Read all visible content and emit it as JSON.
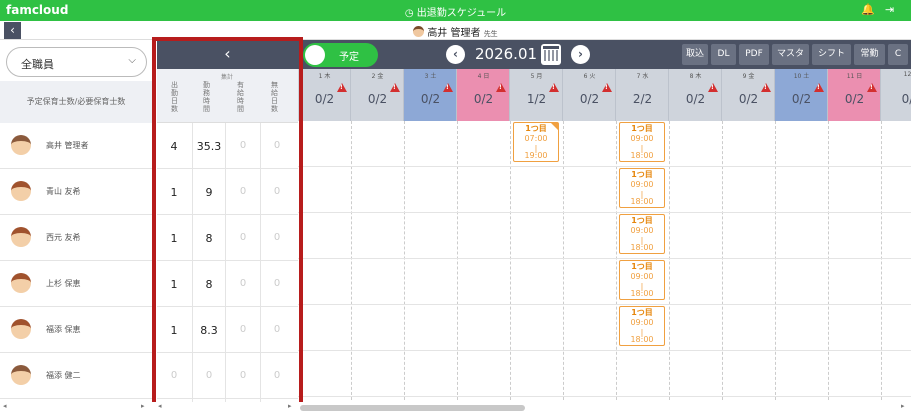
{
  "app": {
    "logo": "famcloud",
    "title": "◷ 出退勤スケジュール",
    "colors": {
      "green": "#2fc144",
      "header": "#4a5163",
      "shift": "#f0a040",
      "highlight": "#b71c1c",
      "saturday": "#8da8d6",
      "sunday": "#eb8fb0",
      "warning": "#d32f2f"
    }
  },
  "icons": {
    "bell": "bell-icon",
    "logout": "logout-icon"
  },
  "subbar": {
    "back": "‹",
    "user_name": "高井 管理者",
    "user_role": "先生"
  },
  "staff_filter": {
    "value": "全職員",
    "chevron": "⌵"
  },
  "required_label": "予定保育士数/必要保育士数",
  "stats": {
    "collapse": "‹",
    "group_label": "集計",
    "columns": [
      "出勤日数",
      "勤務時間",
      "有給時間",
      "無給日数"
    ]
  },
  "calendar": {
    "toggle_label": "予定",
    "prev": "‹",
    "next": "›",
    "month": "2026.01",
    "toolbar": [
      "取込",
      "DL",
      "PDF",
      "マスタ",
      "シフト",
      "常勤",
      "C"
    ]
  },
  "days": [
    {
      "label": "1 木",
      "count": "0/2",
      "warn": true,
      "type": "weekday"
    },
    {
      "label": "2 金",
      "count": "0/2",
      "warn": true,
      "type": "weekday"
    },
    {
      "label": "3 土",
      "count": "0/2",
      "warn": true,
      "type": "sat"
    },
    {
      "label": "4 日",
      "count": "0/2",
      "warn": true,
      "type": "sun"
    },
    {
      "label": "5 月",
      "count": "1/2",
      "warn": true,
      "type": "weekday"
    },
    {
      "label": "6 火",
      "count": "0/2",
      "warn": true,
      "type": "weekday"
    },
    {
      "label": "7 水",
      "count": "2/2",
      "warn": false,
      "type": "weekday"
    },
    {
      "label": "8 木",
      "count": "0/2",
      "warn": true,
      "type": "weekday"
    },
    {
      "label": "9 金",
      "count": "0/2",
      "warn": true,
      "type": "weekday"
    },
    {
      "label": "10 土",
      "count": "0/2",
      "warn": true,
      "type": "sat"
    },
    {
      "label": "11 日",
      "count": "0/2",
      "warn": true,
      "type": "sun"
    },
    {
      "label": "12",
      "count": "0/",
      "warn": false,
      "type": "weekday"
    }
  ],
  "staff": [
    {
      "name": "高井 管理者",
      "gender": "m",
      "days": "4",
      "hours": "35.3",
      "paid": "0",
      "unpaid": "0",
      "muted": false
    },
    {
      "name": "青山 友希",
      "gender": "f",
      "days": "1",
      "hours": "9",
      "paid": "0",
      "unpaid": "0",
      "muted": false
    },
    {
      "name": "西元 友希",
      "gender": "f",
      "days": "1",
      "hours": "8",
      "paid": "0",
      "unpaid": "0",
      "muted": false
    },
    {
      "name": "上杉 保恵",
      "gender": "f",
      "days": "1",
      "hours": "8",
      "paid": "0",
      "unpaid": "0",
      "muted": false
    },
    {
      "name": "福添 保恵",
      "gender": "f",
      "days": "1",
      "hours": "8.3",
      "paid": "0",
      "unpaid": "0",
      "muted": false
    },
    {
      "name": "福添 健二",
      "gender": "m",
      "days": "0",
      "hours": "0",
      "paid": "0",
      "unpaid": "0",
      "muted": true
    }
  ],
  "shifts": [
    {
      "staff": 0,
      "day": 4,
      "type": "1つ目",
      "start": "07:00",
      "end": "19:00",
      "corner": true
    },
    {
      "staff": 0,
      "day": 6,
      "type": "1つ目",
      "start": "09:00",
      "end": "18:00",
      "corner": false
    },
    {
      "staff": 1,
      "day": 6,
      "type": "1つ目",
      "start": "09:00",
      "end": "18:00",
      "corner": false
    },
    {
      "staff": 2,
      "day": 6,
      "type": "1つ目",
      "start": "09:00",
      "end": "18:00",
      "corner": false
    },
    {
      "staff": 3,
      "day": 6,
      "type": "1つ目",
      "start": "09:00",
      "end": "18:00",
      "corner": false
    },
    {
      "staff": 4,
      "day": 6,
      "type": "1つ目",
      "start": "09:00",
      "end": "18:00",
      "corner": false
    }
  ],
  "scroll": {
    "left": "◂",
    "right": "▸"
  }
}
